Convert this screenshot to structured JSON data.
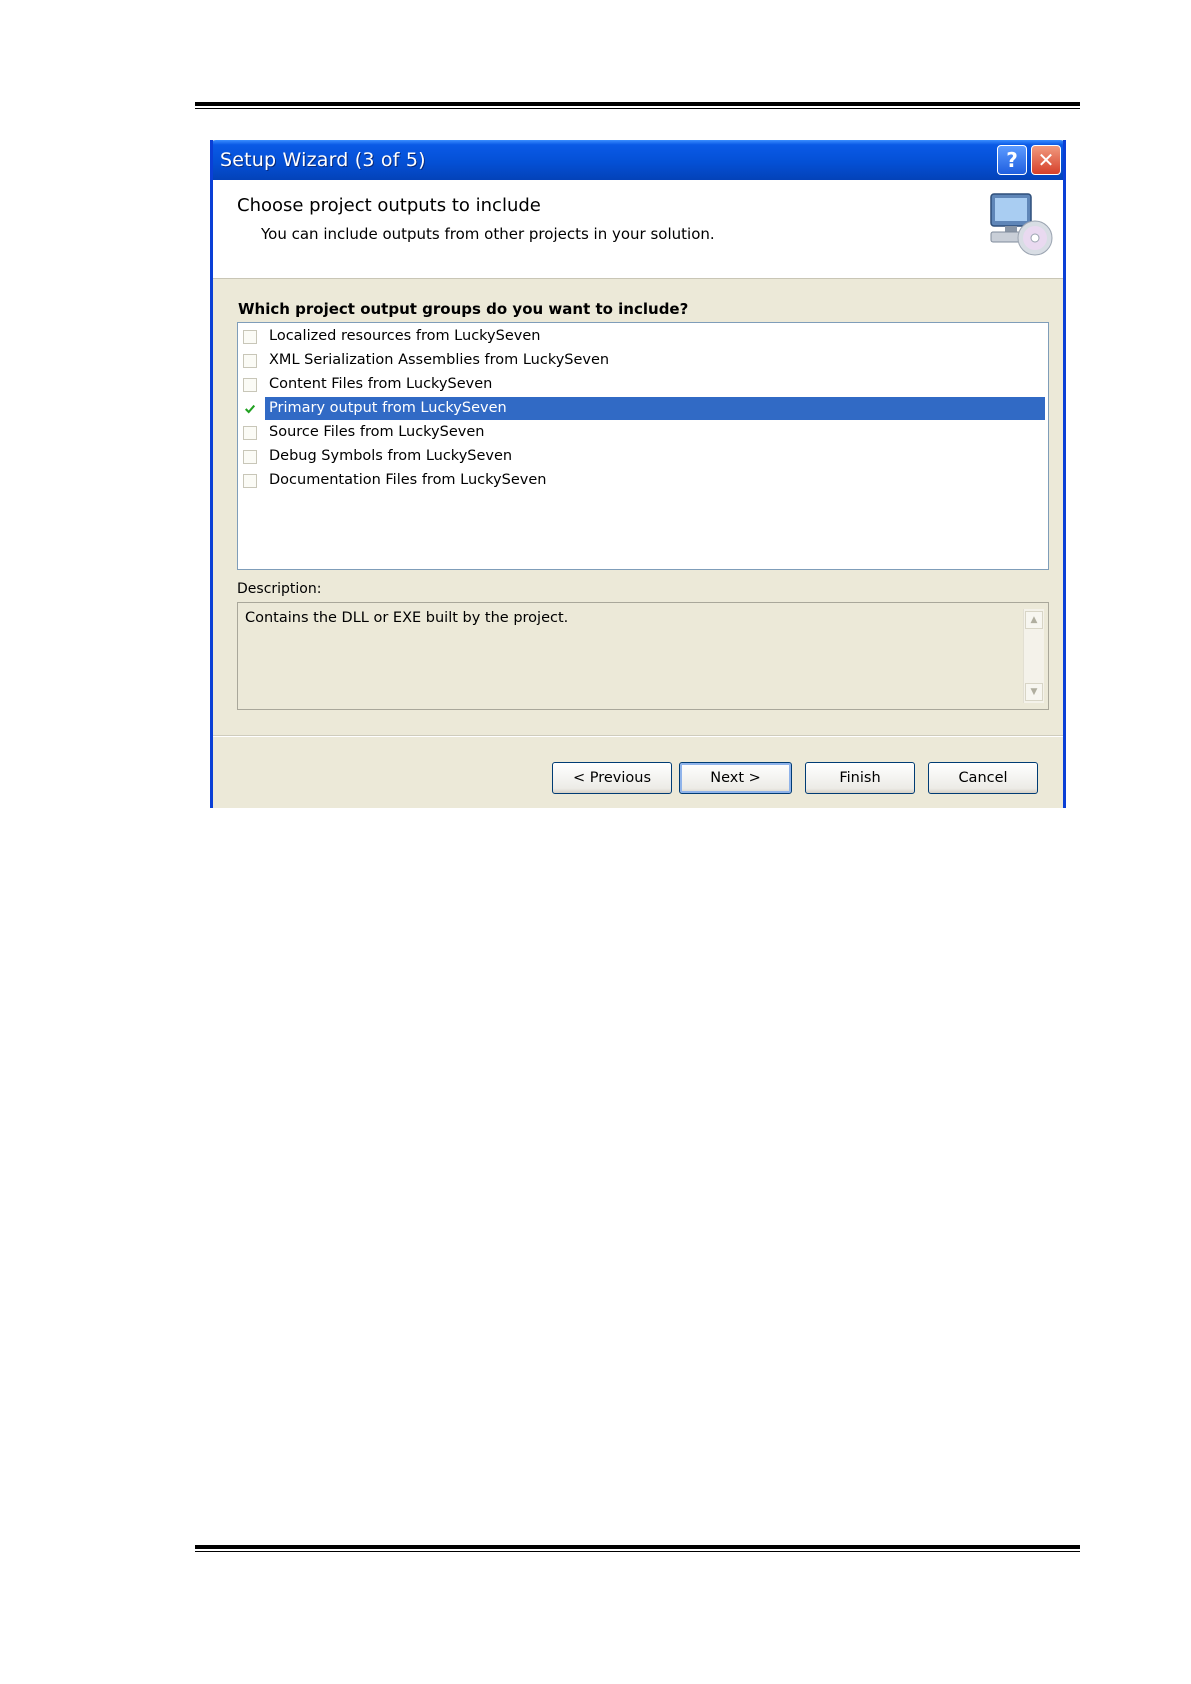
{
  "dialog": {
    "title": "Setup Wizard (3 of 5)",
    "header_title": "Choose project outputs to include",
    "header_subtitle": "You can include outputs from other projects in your solution."
  },
  "list": {
    "question": "Which project output groups do you want to include?",
    "items": [
      {
        "label": "Localized resources from LuckySeven",
        "checked": false,
        "selected": false
      },
      {
        "label": "XML Serialization Assemblies from LuckySeven",
        "checked": false,
        "selected": false
      },
      {
        "label": "Content Files from LuckySeven",
        "checked": false,
        "selected": false
      },
      {
        "label": "Primary output from LuckySeven",
        "checked": true,
        "selected": true
      },
      {
        "label": "Source Files from LuckySeven",
        "checked": false,
        "selected": false
      },
      {
        "label": "Debug Symbols from LuckySeven",
        "checked": false,
        "selected": false
      },
      {
        "label": "Documentation Files from LuckySeven",
        "checked": false,
        "selected": false
      }
    ]
  },
  "description": {
    "label": "Description:",
    "text": "Contains the DLL or EXE built by the project."
  },
  "buttons": {
    "previous": "< Previous",
    "next": "Next >",
    "finish": "Finish",
    "cancel": "Cancel"
  },
  "titlebar_buttons": {
    "help": "?",
    "close": "✕"
  },
  "icons": {
    "header": "computer-with-cd-icon",
    "check": "checkmark-icon",
    "scroll_up": "scroll-up-arrow-icon",
    "scroll_down": "scroll-down-arrow-icon"
  },
  "colors": {
    "title_bar": "#0450d6",
    "selection": "#316ac5",
    "dialog_face": "#ece9d8",
    "check": "#21a121",
    "close_button": "#d6402a"
  }
}
